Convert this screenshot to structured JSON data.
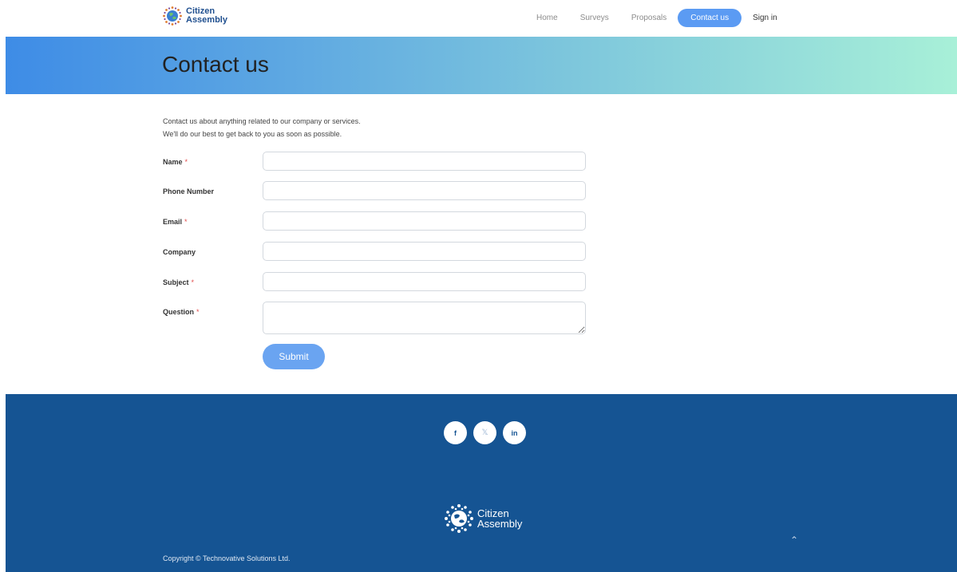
{
  "brand": {
    "line1": "Citizen",
    "line2": "Assembly"
  },
  "nav": {
    "items": [
      {
        "label": "Home",
        "active": false
      },
      {
        "label": "Surveys",
        "active": false
      },
      {
        "label": "Proposals",
        "active": false
      },
      {
        "label": "Contact us",
        "active": true
      },
      {
        "label": "Sign in",
        "active": false
      }
    ]
  },
  "hero": {
    "title": "Contact us"
  },
  "intro": {
    "line1": "Contact us about anything related to our company or services.",
    "line2": "We'll do our best to get back to you as soon as possible."
  },
  "form": {
    "fields": [
      {
        "label": "Name",
        "required": "*",
        "value": ""
      },
      {
        "label": "Phone Number",
        "required": "",
        "value": ""
      },
      {
        "label": "Email",
        "required": "*",
        "value": ""
      },
      {
        "label": "Company",
        "required": "",
        "value": ""
      },
      {
        "label": "Subject",
        "required": "*",
        "value": ""
      },
      {
        "label": "Question",
        "required": "*",
        "value": ""
      }
    ],
    "submit_label": "Submit"
  },
  "footer": {
    "socials": [
      {
        "icon": "facebook-icon",
        "glyph": "f"
      },
      {
        "icon": "x-icon",
        "glyph": "𝕏"
      },
      {
        "icon": "linkedin-icon",
        "glyph": "in"
      }
    ],
    "brand_line1": "Citizen",
    "brand_line2": "Assembly",
    "copyright": "Copyright © Technovative Solutions Ltd.",
    "totop_glyph": "⌃"
  },
  "colors": {
    "accent": "#5b9bf3",
    "footer_bg": "#155493"
  }
}
